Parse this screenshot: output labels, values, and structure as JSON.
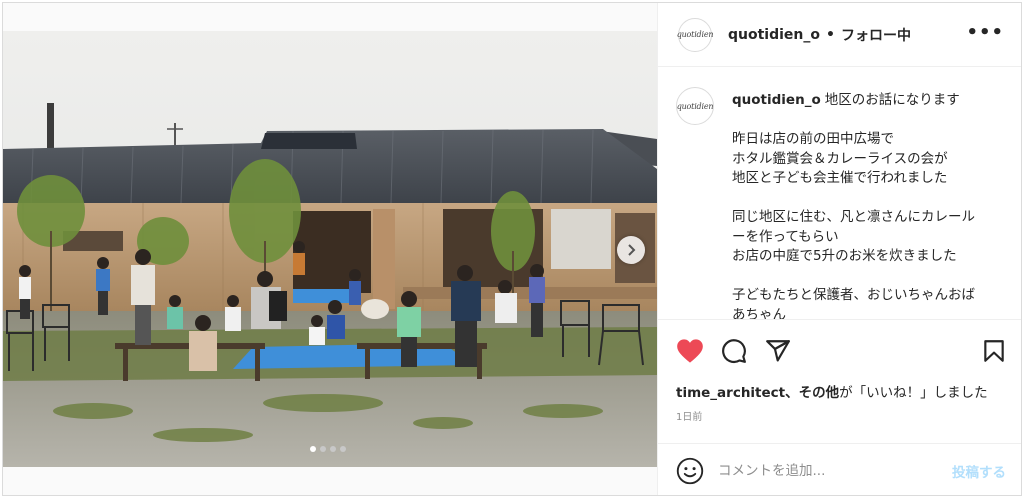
{
  "post": {
    "username": "quotidien_o",
    "separator": "•",
    "follow_status": "フォロー中",
    "more_label": "•••",
    "avatar_text": "quotidien"
  },
  "caption": {
    "username": "quotidien_o",
    "lines": [
      "地区のお話になります",
      "",
      "昨日は店の前の田中広場で",
      "ホタル鑑賞会＆カレーライスの会が",
      "地区と子ども会主催で行われました",
      "",
      "同じ地区に住む、凡と凛さんにカレール",
      "ーを作ってもらい",
      "お店の中庭で5升のお米を炊きました",
      "",
      "子どもたちと保護者、おじいちゃんおば",
      "あちゃん"
    ]
  },
  "likes": {
    "user": "time_architect",
    "others": "、その他",
    "suffix": "が「いいね！」しました"
  },
  "time_ago": "1日前",
  "comment": {
    "placeholder": "コメントを追加...",
    "post_label": "投稿する"
  },
  "carousel": {
    "count": 4,
    "active_index": 0
  },
  "colors": {
    "like_red": "#ed4956",
    "post_disabled": "#b2dffc",
    "text": "#262626",
    "muted": "#8e8e8e"
  }
}
